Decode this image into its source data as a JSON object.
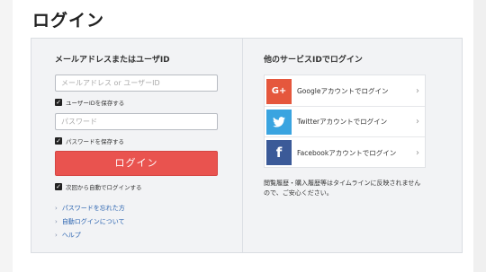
{
  "page": {
    "title": "ログイン"
  },
  "login": {
    "section_title": "メールアドレスまたはユーザID",
    "email_placeholder": "メールアドレス or ユーザーID",
    "remember_id_label": "ユーザーIDを保存する",
    "password_placeholder": "パスワード",
    "remember_password_label": "パスワードを保存する",
    "login_button_label": "ログイン",
    "auto_login_label": "次回から自動でログインする",
    "help_links": [
      {
        "label": "パスワードを忘れた方"
      },
      {
        "label": "自動ログインについて"
      },
      {
        "label": "ヘルプ"
      }
    ]
  },
  "services": {
    "section_title": "他のサービスIDでログイン",
    "items": [
      {
        "icon": "google-plus-icon",
        "icon_text": "G+",
        "color": "#e5573d",
        "label": "Googleアカウントでログイン"
      },
      {
        "icon": "twitter-icon",
        "icon_text": "t",
        "color": "#3aa4e0",
        "label": "Twitterアカウントでログイン"
      },
      {
        "icon": "facebook-icon",
        "icon_text": "f",
        "color": "#3b5a98",
        "label": "Facebookアカウントでログイン"
      }
    ],
    "note": "閲覧履歴・購入履歴等はタイムラインに反映されませんので、ご安心ください。"
  },
  "colors": {
    "login_button": "#e9534f",
    "link": "#2a63b0",
    "panel_bg": "#f2f3f5"
  }
}
